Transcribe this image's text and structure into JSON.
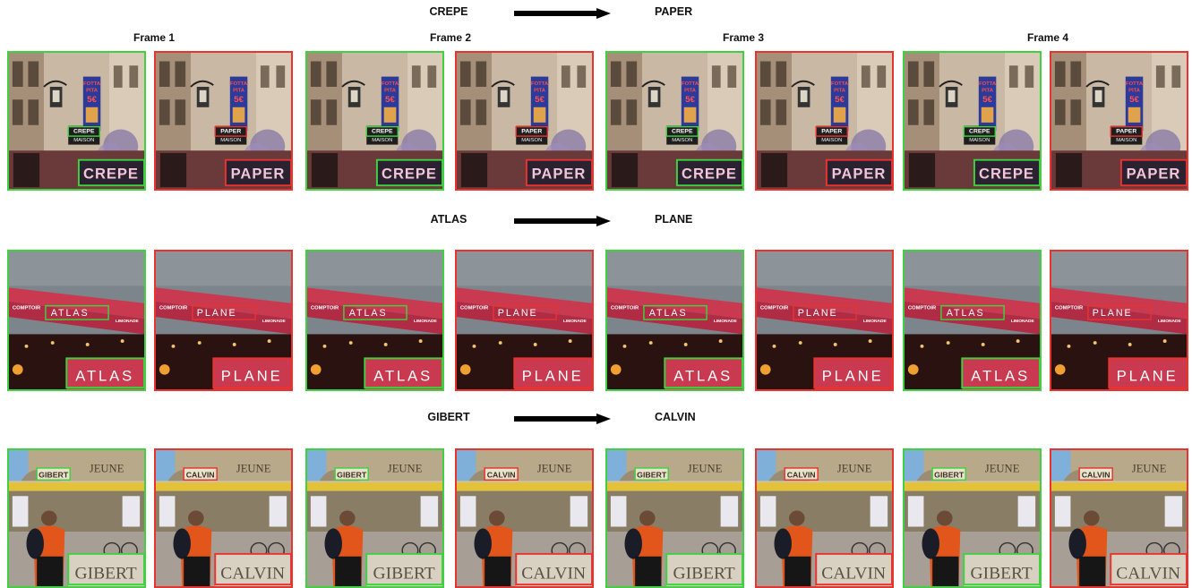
{
  "frame_labels": [
    "Frame 1",
    "Frame 2",
    "Frame 3",
    "Frame 4"
  ],
  "colors": {
    "source_box": "#3fd13f",
    "target_box": "#e8332f",
    "text": "#111111"
  },
  "rows": [
    {
      "source_word": "CREPE",
      "target_word": "PAPER",
      "scene": "street-sign",
      "sub_word": "MAISON",
      "poster_text": [
        "FOTTA",
        "PITA",
        "5€"
      ]
    },
    {
      "source_word": "ATLAS",
      "target_word": "PLANE",
      "scene": "awning",
      "awning_left_text": "COMPTOIR",
      "awning_right_text": "LIMONADE"
    },
    {
      "source_word": "GIBERT",
      "target_word": "CALVIN",
      "scene": "plaza",
      "building_text": "JEUNE"
    }
  ]
}
